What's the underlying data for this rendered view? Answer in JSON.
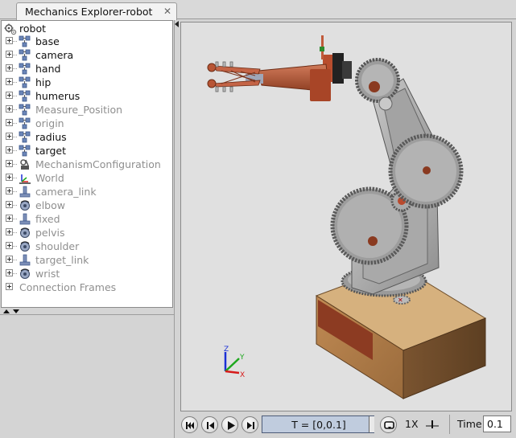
{
  "window": {
    "tab_title": "Mechanics Explorer-robot",
    "tab_close": "✕"
  },
  "tree": {
    "root": {
      "label": "robot",
      "icon": "model-gear-icon"
    },
    "items": [
      {
        "label": "base",
        "icon": "subsystem-icon",
        "active": true
      },
      {
        "label": "camera",
        "icon": "subsystem-icon",
        "active": true
      },
      {
        "label": "hand",
        "icon": "subsystem-icon",
        "active": true
      },
      {
        "label": "hip",
        "icon": "subsystem-icon",
        "active": true
      },
      {
        "label": "humerus",
        "icon": "subsystem-icon",
        "active": true
      },
      {
        "label": "Measure_Position",
        "icon": "subsystem-icon",
        "active": false
      },
      {
        "label": "origin",
        "icon": "subsystem-icon",
        "active": false
      },
      {
        "label": "radius",
        "icon": "subsystem-icon",
        "active": true
      },
      {
        "label": "target",
        "icon": "subsystem-icon",
        "active": true
      },
      {
        "label": "MechanismConfiguration",
        "icon": "mechanism-config-icon",
        "active": false
      },
      {
        "label": "World",
        "icon": "world-frame-icon",
        "active": false
      },
      {
        "label": "camera_link",
        "icon": "weld-joint-icon",
        "active": false
      },
      {
        "label": "elbow",
        "icon": "revolute-joint-icon",
        "active": false
      },
      {
        "label": "fixed",
        "icon": "weld-joint-icon",
        "active": false
      },
      {
        "label": "pelvis",
        "icon": "revolute-joint-icon",
        "active": false
      },
      {
        "label": "shoulder",
        "icon": "revolute-joint-icon",
        "active": false
      },
      {
        "label": "target_link",
        "icon": "weld-joint-icon",
        "active": false
      },
      {
        "label": "wrist",
        "icon": "revolute-joint-icon",
        "active": false
      }
    ],
    "footer_item": {
      "label": "Connection Frames"
    }
  },
  "viewport": {
    "triad": {
      "x": "X",
      "y": "Y",
      "z": "Z"
    }
  },
  "playback": {
    "buttons": [
      "skip-to-start-icon",
      "step-back-icon",
      "play-icon",
      "step-forward-icon"
    ],
    "time_range": "T = [0,0.1]",
    "loop_icon": "loop-icon",
    "speed": "1X",
    "time_label": "Time",
    "time_value": "0.1"
  },
  "colors": {
    "tree_bg": "#ffffff",
    "inactive_text": "#8f8f8f",
    "viewport_bg": "#e0e0e0",
    "time_field": "#c0ccde"
  }
}
